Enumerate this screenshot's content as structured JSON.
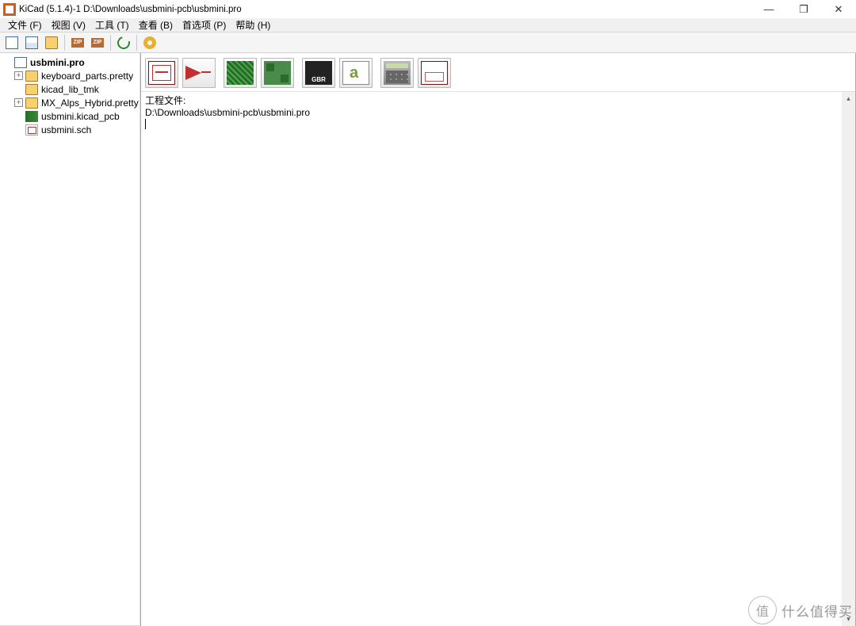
{
  "title": "KiCad (5.1.4)-1 D:\\Downloads\\usbmini-pcb\\usbmini.pro",
  "menu": {
    "file": "文件 (F)",
    "view": "视图 (V)",
    "tools": "工具 (T)",
    "browse": "查看 (B)",
    "prefs": "首选项 (P)",
    "help": "帮助 (H)"
  },
  "tree": {
    "root": "usbmini.pro",
    "items": [
      {
        "label": "keyboard_parts.pretty",
        "type": "folder",
        "expandable": true
      },
      {
        "label": "kicad_lib_tmk",
        "type": "folder",
        "expandable": false
      },
      {
        "label": "MX_Alps_Hybrid.pretty",
        "type": "folder",
        "expandable": true
      },
      {
        "label": "usbmini.kicad_pcb",
        "type": "pcb",
        "expandable": false
      },
      {
        "label": "usbmini.sch",
        "type": "sch",
        "expandable": false
      }
    ]
  },
  "info": {
    "heading": "工程文件:",
    "path": "D:\\Downloads\\usbmini-pcb\\usbmini.pro"
  },
  "gerber_label": "GBR",
  "watermark_text": "什么值得买",
  "watermark_logo": "值"
}
